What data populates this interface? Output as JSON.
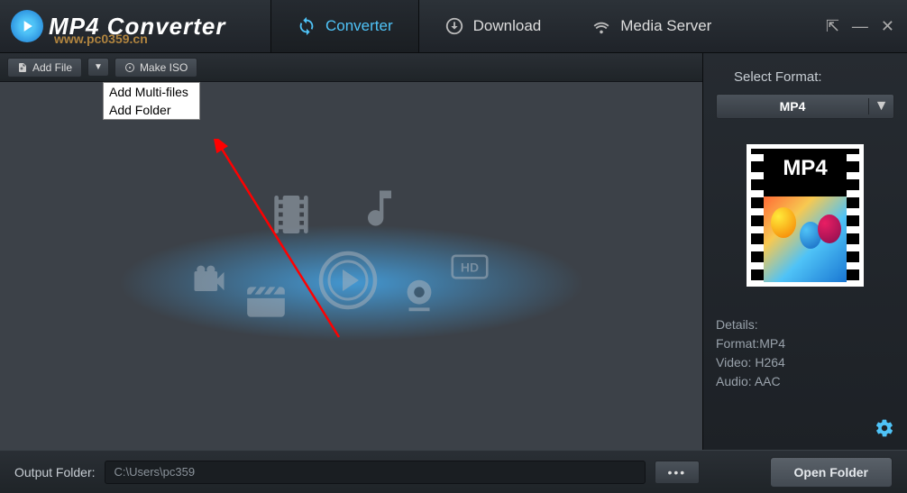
{
  "app": {
    "title": "MP4 Converter"
  },
  "watermark": "www.pc0359.cn",
  "tabs": [
    {
      "label": "Converter",
      "icon": "convert-icon",
      "active": true
    },
    {
      "label": "Download",
      "icon": "download-icon",
      "active": false
    },
    {
      "label": "Media Server",
      "icon": "wifi-icon",
      "active": false
    }
  ],
  "toolbar": {
    "add_file": "Add File",
    "make_iso": "Make ISO"
  },
  "dropdown": {
    "items": [
      "Add Multi-files",
      "Add Folder"
    ]
  },
  "sidebar": {
    "select_format_label": "Select Format:",
    "selected_format": "MP4",
    "preview_label": "MP4",
    "details_heading": "Details:",
    "format_line": "Format:MP4",
    "video_line": "Video: H264",
    "audio_line": "Audio: AAC"
  },
  "bottom": {
    "output_label": "Output Folder:",
    "output_path": "C:\\Users\\pc359",
    "browse_label": "•••",
    "open_folder": "Open Folder"
  }
}
